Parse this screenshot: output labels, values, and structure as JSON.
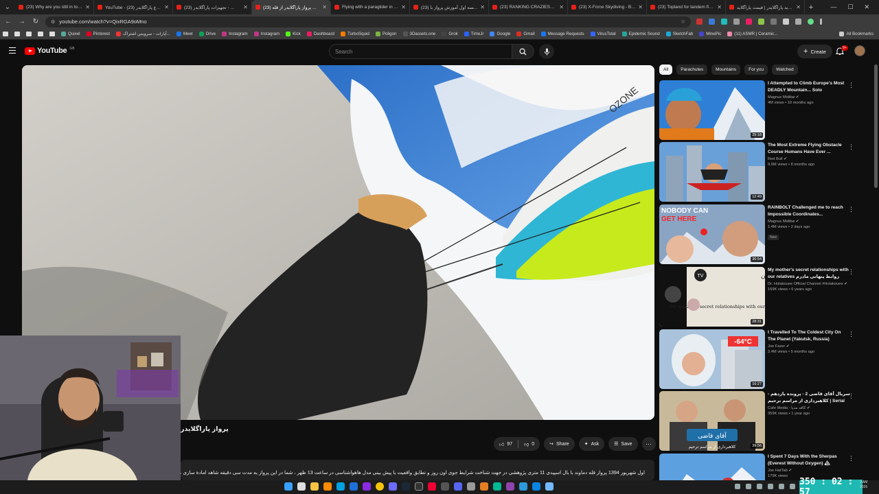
{
  "browser": {
    "tabs": [
      {
        "title": "(23) Why are you still in touch",
        "active": false
      },
      {
        "title": "YouTube - شروع پاراگلایدر (23)",
        "active": false
      },
      {
        "title": "تجهیزات پاراگلایدر (23) - ...",
        "active": false
      },
      {
        "title": "پرواز پاراگلایدر از قله (23) ...",
        "active": true
      },
      {
        "title": "Flying with a paraglider in Ra...",
        "active": false
      },
      {
        "title": "جلسه اول آموزش پرواز با (23) ...",
        "active": false
      },
      {
        "title": "(23) RANKING CRAZIEST PAR...",
        "active": false
      },
      {
        "title": "(23) X-Force Skydiving - Brad...",
        "active": false
      },
      {
        "title": "(23) Topland for tandem fly R...",
        "active": false
      },
      {
        "title": "خرید پاراگلایدر | قیمت پاراگلاید...",
        "active": false
      }
    ],
    "url": "youtube.com/watch?v=QixRGA9oMno",
    "bookmarks": [
      "Quixel",
      "Pinterest",
      "آپارات - سرویس اشتراک...",
      "Meet",
      "Drive",
      "Instagram",
      "Instagram",
      "Kick",
      "Dashboard",
      "TurboSquid",
      "Poligon",
      "3Dassets.one",
      "Grok",
      "TimeJr",
      "Google",
      "Gmail",
      "Message Requests",
      "VirusTotal",
      "Epidemic Sound",
      "SketchFab",
      "MinePic",
      "(11) ASMR | Ceramic..."
    ],
    "all_bookmarks": "All Bookmarks"
  },
  "youtube": {
    "logo_text": "YouTube",
    "logo_region": "GB",
    "search_placeholder": "Search",
    "create_label": "Create",
    "notification_count": "9+"
  },
  "video": {
    "title": "پرواز پاراگلایدر",
    "likes": "97",
    "dislikes": "0",
    "share_label": "Share",
    "ask_label": "Ask",
    "save_label": "Save",
    "description": "اول شهریور 1394 پرواز قله دماوند با بال اسپیدی 11 متری پژوهشی در جهت شناخت شرایط جوی اون روز و تطابق واقعیت با پیش بینی مدل هاهواشناسی در ساعت 13 ظهر ، شما در این پرواز به مدت سی دقیقه شاهد امادة سازی ،چالش ها و"
  },
  "chips": [
    "All",
    "Parachutes",
    "Mountains",
    "For you",
    "Watched"
  ],
  "recommendations": [
    {
      "title": "I Attempted to Climb Europe's Most DEADLY Mountain... Solo",
      "channel": "Magnus Midtbø",
      "meta": "4M views • 10 months ago",
      "duration": "25:18",
      "new": ""
    },
    {
      "title": "The Most Extreme Flying Obstacle Course Humans Have Ever ...",
      "channel": "Red Bull",
      "meta": "9.6M views • 8 months ago",
      "duration": "12:49",
      "new": ""
    },
    {
      "title": "RAINBOLT Challenged me to reach Impossible Coordinates...",
      "channel": "Magnus Midtbø",
      "meta": "1.4M views • 2 days ago",
      "duration": "36:54",
      "new": "New"
    },
    {
      "title": "My mother's secret relationships with our relatives روابط پنهانی مادرم",
      "channel": "Dr. Holakouee Official Channel #Holakouee",
      "meta": "169K views • 6 years ago",
      "duration": "28:31",
      "new": ""
    },
    {
      "title": "I Travelled To The Coldest City On The Planet (Yakutsk, Russia)",
      "channel": "Joe Fazer",
      "meta": "3.4M views • 5 months ago",
      "duration": "16:27",
      "new": ""
    },
    {
      "title": "سریال آقای قاضی 2 - پرونده یازدهم - کلاهبرداری از مراسم ترحیم | Serial",
      "channel": "Cafe Media - کافه مدیا",
      "meta": "359K views • 1 year ago",
      "duration": "39:56",
      "new": ""
    },
    {
      "title": "I Spent 7 Days With the Sherpas (Everest Without Oxygen) 🏔",
      "channel": "Joe HatTab",
      "meta": "179K views",
      "duration": "",
      "new": ""
    }
  ],
  "thumb_text": {
    "rec3_line1": "NOBODY CAN",
    "rec3_line2": "GET HERE",
    "rec4_persian": "روابط پنهانی مادرم با خویشاوندان",
    "rec4_english": "My mother's secret relationships with our relatives",
    "rec5_temp": "-64°C",
    "rec6_title": "آقای قاضی",
    "rec6_sub": "کلاهبرداری از مراسم ترحیم"
  },
  "overlay": {
    "timer": "350 : 02 : 57",
    "clock_time": "9 AM",
    "clock_date": "2026"
  }
}
